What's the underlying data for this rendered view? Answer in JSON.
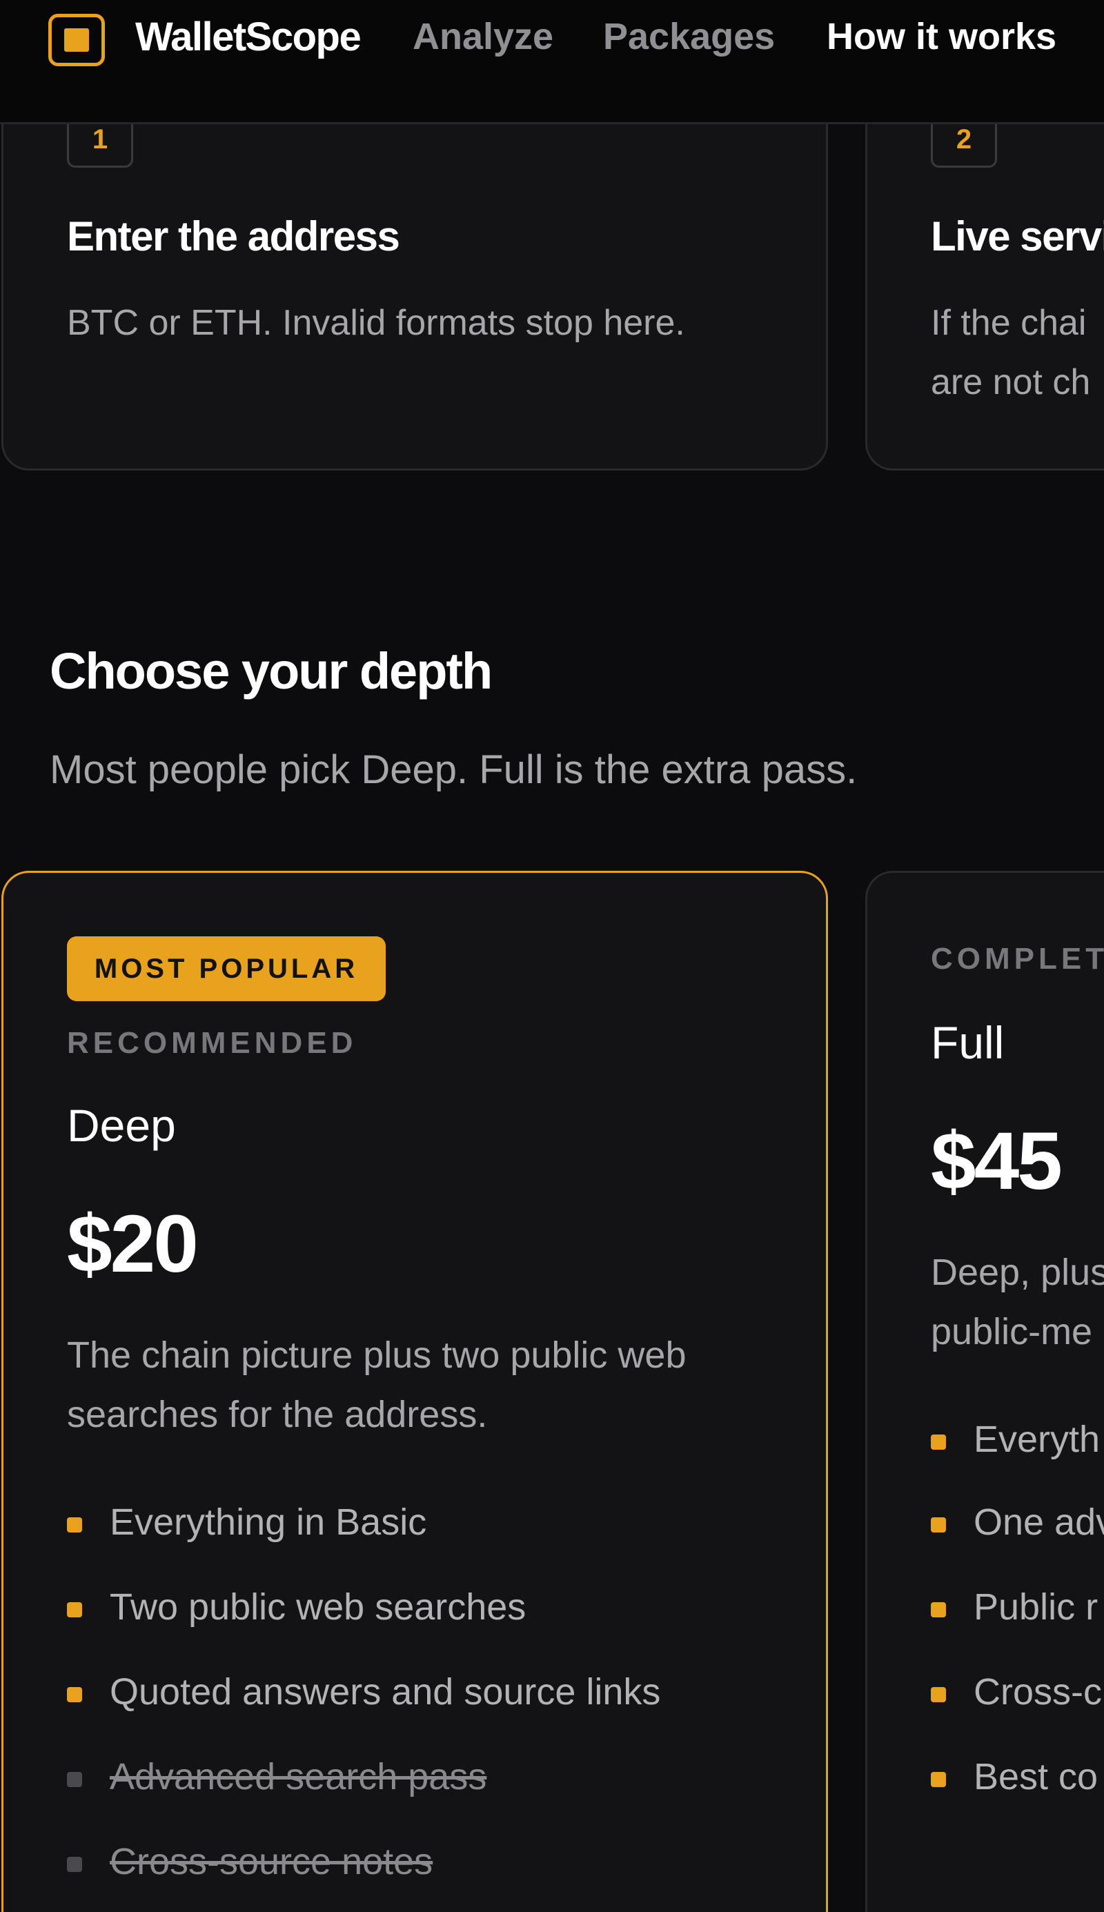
{
  "header": {
    "brand": "WalletScope",
    "nav": {
      "analyze": "Analyze",
      "packages": "Packages",
      "how_it_works": "How it works"
    }
  },
  "steps": [
    {
      "number": "1",
      "title": "Enter the address",
      "description": [
        "BTC or ETH. Invalid formats stop here."
      ]
    },
    {
      "number": "2",
      "title": "Live servi",
      "description": [
        "If the chai",
        "are not ch"
      ]
    }
  ],
  "section": {
    "title": "Choose your depth",
    "subtitle": "Most people pick Deep. Full is the extra pass."
  },
  "plans": {
    "deep": {
      "badge": "MOST POPULAR",
      "eyebrow": "RECOMMENDED",
      "name": "Deep",
      "price": "$20",
      "description": [
        "The chain picture plus two public web",
        "searches for the address."
      ],
      "features": [
        {
          "text": "Everything in Basic",
          "included": true
        },
        {
          "text": "Two public web searches",
          "included": true
        },
        {
          "text": "Quoted answers and source links",
          "included": true
        },
        {
          "text": "Advanced search pass",
          "included": false
        },
        {
          "text": "Cross-source notes",
          "included": false
        }
      ]
    },
    "full": {
      "eyebrow": "COMPLET",
      "name": "Full",
      "price": "$45",
      "description": [
        "Deep, plus",
        "public-me"
      ],
      "features": [
        {
          "text": "Everyth",
          "included": true
        },
        {
          "text": "One adv",
          "included": true
        },
        {
          "text": "Public r",
          "included": true
        },
        {
          "text": "Cross-c",
          "included": true
        },
        {
          "text": "Best co",
          "included": true
        }
      ]
    }
  },
  "colors": {
    "accent": "#e9a21d",
    "background": "#0c0c0e",
    "card": "#131316"
  }
}
